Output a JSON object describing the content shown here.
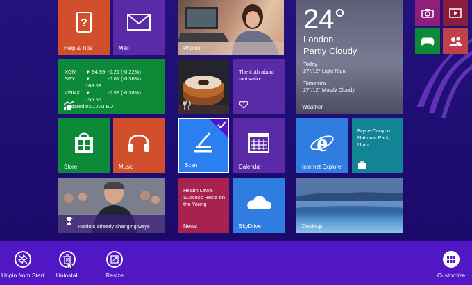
{
  "tiles": {
    "help": "Help & Tips",
    "mail": "Mail",
    "photos": "Photos",
    "finance": {
      "rows": [
        {
          "sym": "XOM",
          "val": "▼ 94.99",
          "chg": "-0.21 (-0.22%)"
        },
        {
          "sym": "SPY",
          "val": "▼ 168.53",
          "chg": "-0.61 (-0.36%)"
        },
        {
          "sym": "VFINX",
          "val": "▼ 155.55",
          "chg": "-0.59 (-0.38%)"
        }
      ],
      "updated_label": "Updated",
      "updated_time": "9:01 AM EDT"
    },
    "health_small": "The truth about motivation",
    "weather": {
      "temp": "24°",
      "city": "London",
      "cond": "Partly Cloudy",
      "today_label": "Today",
      "today": "27°/12° Light Rain",
      "tomorrow_label": "Tomorrow",
      "tomorrow": "27°/12° Mostly Cloudy",
      "name": "Weather"
    },
    "store": "Store",
    "music": "Music",
    "scan": "Scan",
    "calendar": "Calendar",
    "ie": "Internet Explorer",
    "travel": "Bryce Canyon National Park, Utah",
    "sports": "Patriots already changing ways",
    "news_text": "Health Law's Success Rests on the Young",
    "news": "News",
    "skydrive": "SkyDrive",
    "desktop": "Desktop"
  },
  "appbar": {
    "unpin": "Unpin from Start",
    "uninstall": "Uninstall",
    "resize": "Resize",
    "customize": "Customize"
  },
  "colors": {
    "background": "#1d0b6e",
    "appbar": "#5217c5",
    "tile_orange": "#d14f2c",
    "tile_green": "#0d8a38",
    "tile_purple": "#5b2aa6",
    "tile_blue": "#2f7de1",
    "tile_teal": "#128495",
    "tile_magenta": "#8f1f7c",
    "selected_scan": "#2b7ff1"
  }
}
